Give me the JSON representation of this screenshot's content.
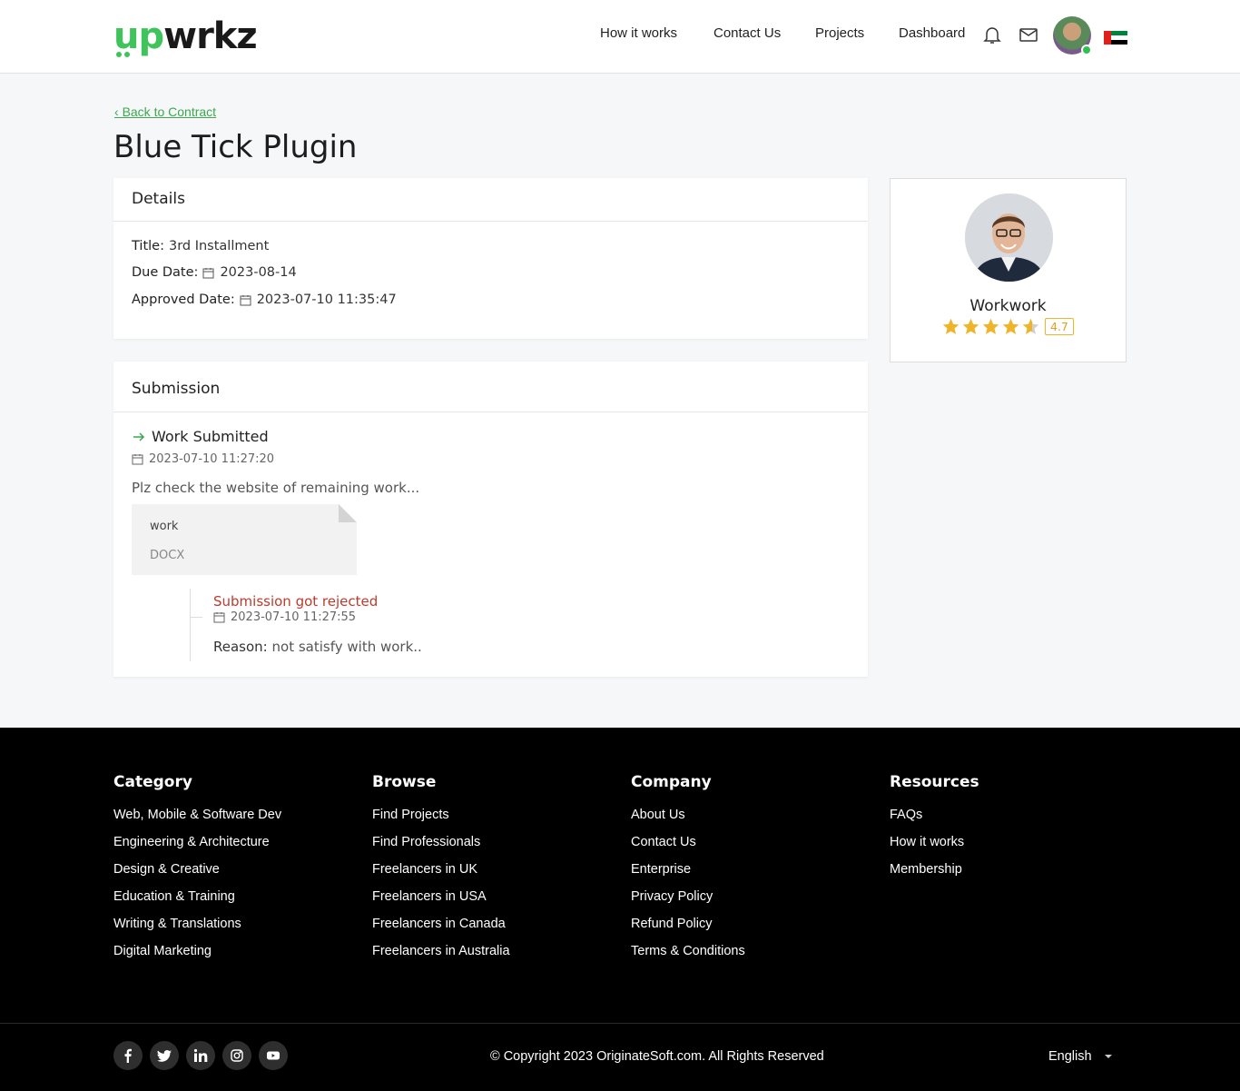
{
  "header": {
    "logo_up": "up",
    "logo_wrkz": "wrkz",
    "nav": [
      "How it works",
      "Contact Us",
      "Projects",
      "Dashboard"
    ],
    "icons": [
      "bell-icon",
      "mail-icon"
    ],
    "accent": "#3ec45a"
  },
  "page": {
    "back_link": "Back to Contract",
    "title": "Blue Tick Plugin"
  },
  "details": {
    "heading": "Details",
    "title_label": "Title:",
    "title_value": "3rd Installment",
    "due_label": "Due Date:",
    "due_value": "2023-08-14",
    "approved_label": "Approved Date:",
    "approved_value": "2023-07-10 11:35:47"
  },
  "submission": {
    "heading": "Submission",
    "status": "Work Submitted",
    "date": "2023-07-10 11:27:20",
    "message": "Plz check the website of remaining work...",
    "file_name": "work",
    "file_type": "DOCX",
    "rejection_title": "Submission got rejected",
    "rejection_date": "2023-07-10 11:27:55",
    "reason_label": "Reason:",
    "reason_value": "not satisfy with work..",
    "rejected_color": "#c0392b"
  },
  "profile": {
    "name": "Workwork",
    "rating": "4.7",
    "rating_value": 4.7,
    "star_color": "#f0b429"
  },
  "footer": {
    "category": {
      "heading": "Category",
      "links": [
        "Web, Mobile & Software Dev",
        "Engineering & Architecture",
        "Design & Creative",
        "Education & Training",
        "Writing & Translations",
        "Digital Marketing"
      ]
    },
    "browse": {
      "heading": "Browse",
      "links": [
        "Find Projects",
        "Find Professionals",
        "Freelancers in UK",
        "Freelancers in USA",
        "Freelancers in Canada",
        "Freelancers in Australia"
      ]
    },
    "company": {
      "heading": "Company",
      "links": [
        "About Us",
        "Contact Us",
        "Enterprise",
        "Privacy Policy",
        "Refund Policy",
        "Terms & Conditions"
      ]
    },
    "resources": {
      "heading": "Resources",
      "links": [
        "FAQs",
        "How it works",
        "Membership"
      ]
    },
    "social": [
      "facebook-icon",
      "twitter-icon",
      "linkedin-icon",
      "instagram-icon",
      "youtube-icon"
    ],
    "copyright": "© Copyright 2023 OriginateSoft.com. All Rights Reserved",
    "language": "English"
  }
}
